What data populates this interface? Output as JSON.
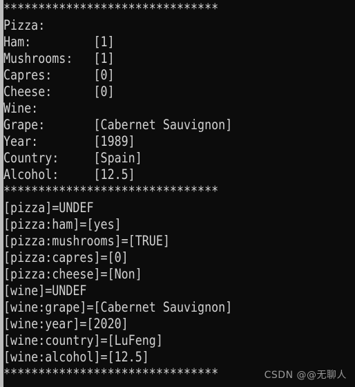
{
  "console": {
    "background_color": "#0c0c0c",
    "text_color": "#d2d2d2",
    "scrollbar_color": "#c8c8c8",
    "lines": [
      "*******************************",
      "Pizza:",
      "Ham:         [1]",
      "Mushrooms:   [1]",
      "Capres:      [0]",
      "Cheese:      [0]",
      "Wine:",
      "Grape:       [Cabernet Sauvignon]",
      "Year:        [1989]",
      "Country:     [Spain]",
      "Alcohol:     [12.5]",
      "*******************************",
      "[pizza]=UNDEF",
      "[pizza:ham]=[yes]",
      "[pizza:mushrooms]=[TRUE]",
      "[pizza:capres]=[0]",
      "[pizza:cheese]=[Non]",
      "[wine]=UNDEF",
      "[wine:grape]=[Cabernet Sauvignon]",
      "[wine:year]=[2020]",
      "[wine:country]=[LuFeng]",
      "[wine:alcohol]=[12.5]",
      "*******************************"
    ]
  },
  "watermark": {
    "text": "CSDN @@无聊人",
    "color": "#9a9a9a"
  }
}
